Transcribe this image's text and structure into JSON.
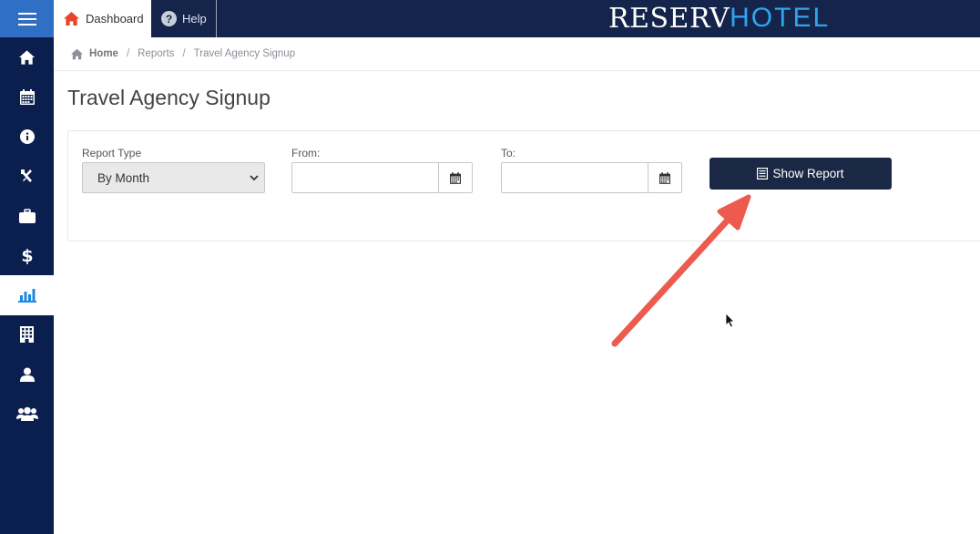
{
  "header": {
    "tabs": [
      {
        "label": "Dashboard",
        "icon": "home-icon"
      },
      {
        "label": "Help",
        "icon": "help-icon"
      }
    ],
    "logo_text_part1": "RESERV",
    "logo_text_part2": "HOTEL"
  },
  "sidebar": {
    "items": [
      {
        "icon": "home-icon"
      },
      {
        "icon": "calendar-icon"
      },
      {
        "icon": "info-icon"
      },
      {
        "icon": "tools-icon"
      },
      {
        "icon": "briefcase-icon"
      },
      {
        "icon": "dollar-icon"
      },
      {
        "icon": "bar-chart-icon",
        "active": true
      },
      {
        "icon": "building-icon"
      },
      {
        "icon": "user-icon"
      },
      {
        "icon": "users-icon"
      }
    ]
  },
  "breadcrumb": {
    "home": "Home",
    "reports": "Reports",
    "current": "Travel Agency Signup",
    "separator": "/"
  },
  "page": {
    "title": "Travel Agency Signup"
  },
  "form": {
    "report_type_label": "Report Type",
    "report_type_value": "By Month",
    "from_label": "From:",
    "from_value": "",
    "to_label": "To:",
    "to_value": "",
    "show_button": "Show Report"
  },
  "colors": {
    "topbar": "#14244a",
    "sidebar": "#0b1f4e",
    "accent": "#2f6fc4",
    "button": "#1b2845",
    "annotation_arrow": "#ec5b4e"
  }
}
